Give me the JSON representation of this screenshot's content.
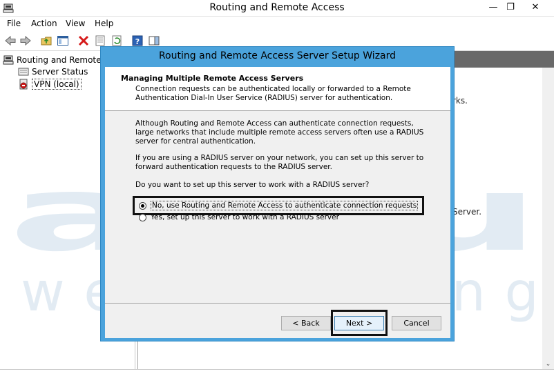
{
  "window": {
    "title": "Routing and Remote Access",
    "controls": {
      "minimize": "—",
      "maximize": "❐",
      "close": "✕"
    }
  },
  "menu": {
    "file": "File",
    "action": "Action",
    "view": "View",
    "help": "Help"
  },
  "toolbar": {
    "buttons": [
      "back-arrow-icon",
      "forward-arrow-icon",
      "up-folder-icon",
      "show-hide-tree-icon",
      "delete-icon",
      "properties-icon",
      "refresh-icon",
      "help-icon",
      "action-pane-icon"
    ]
  },
  "tree": {
    "root": "Routing and Remote A",
    "server_status": "Server Status",
    "vpn": "VPN (local)"
  },
  "right_pane": {
    "fragment_1": "rks.",
    "fragment_2": "Server."
  },
  "watermark": {
    "brand": "accu",
    "tagline": "web hosting"
  },
  "wizard": {
    "title": "Routing and Remote Access Server Setup Wizard",
    "header_title": "Managing Multiple Remote Access Servers",
    "header_desc": "Connection requests can be authenticated locally or forwarded to a Remote Authentication Dial-In User Service (RADIUS) server for authentication.",
    "para1": "Although Routing and Remote Access can authenticate connection requests, large networks that include multiple remote access servers often use a RADIUS server for central authentication.",
    "para2": "If you are using a RADIUS server on your network, you can set up this server to forward authentication requests to the RADIUS server.",
    "question": "Do you want to set up this server to work with a RADIUS server?",
    "option_no": {
      "label": "No, use Routing and Remote Access to authenticate connection requests",
      "selected": true
    },
    "option_yes": {
      "label": "Yes, set up this server to work with a RADIUS server",
      "selected": false
    },
    "buttons": {
      "back": "< Back",
      "next": "Next >",
      "cancel": "Cancel"
    }
  },
  "colors": {
    "wizard_border": "#4ba3dc",
    "header_bar": "#696969",
    "watermark": "#dde8f1"
  }
}
